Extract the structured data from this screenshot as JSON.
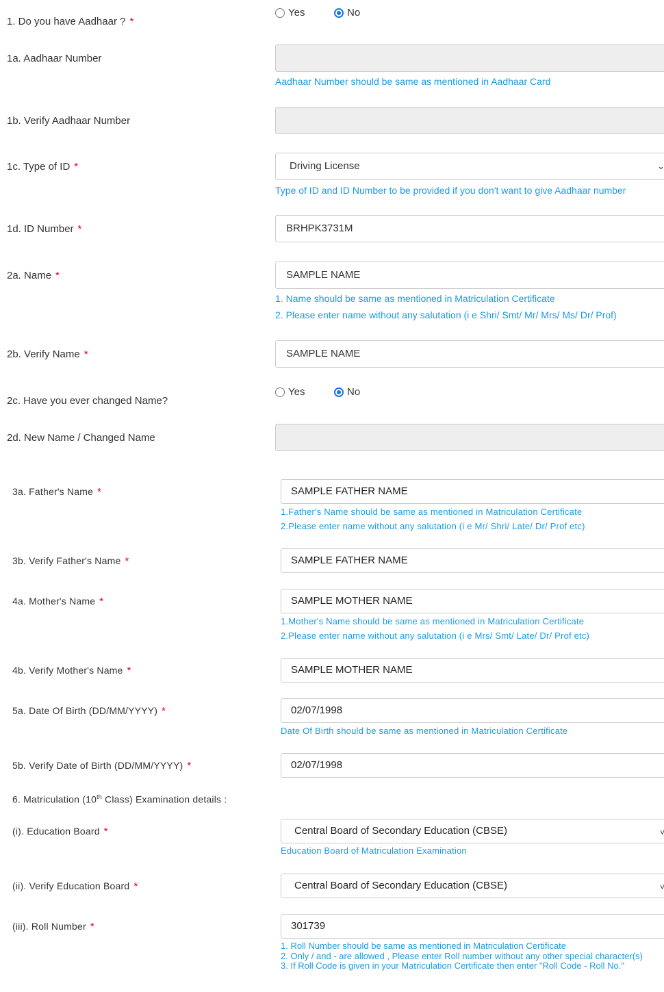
{
  "q1": {
    "label": "1. Do you have Aadhaar ?",
    "req": "*",
    "opt_yes": "Yes",
    "opt_no": "No",
    "selected": "No"
  },
  "q1a": {
    "label": "1a. Aadhaar Number",
    "value": "",
    "help": "Aadhaar Number should be same as mentioned in Aadhaar Card"
  },
  "q1b": {
    "label": "1b. Verify Aadhaar Number",
    "value": ""
  },
  "q1c": {
    "label": "1c. Type of ID",
    "req": "*",
    "value": "Driving License",
    "help": "Type of ID and ID Number to be provided if you don't want to give Aadhaar number"
  },
  "q1d": {
    "label": "1d. ID Number",
    "req": "*",
    "value": "BRHPK3731M"
  },
  "q2a": {
    "label": "2a. Name",
    "req": "*",
    "value": "SAMPLE NAME",
    "help1": "1. Name should be same as mentioned in Matriculation Certificate",
    "help2": "2. Please enter name without any salutation (i e Shri/ Smt/ Mr/ Mrs/ Ms/ Dr/ Prof)"
  },
  "q2b": {
    "label": "2b. Verify Name",
    "req": "*",
    "value": "SAMPLE NAME"
  },
  "q2c": {
    "label": "2c. Have you ever changed Name?",
    "opt_yes": "Yes",
    "opt_no": "No",
    "selected": "No"
  },
  "q2d": {
    "label": "2d. New Name / Changed Name",
    "value": ""
  },
  "q3a": {
    "label": "3a. Father's Name",
    "req": "*",
    "value": "SAMPLE FATHER NAME",
    "help1": "1.Father's Name should be same as mentioned in Matriculation Certificate",
    "help2": "2.Please enter name without any salutation (i e Mr/ Shri/ Late/ Dr/ Prof etc)"
  },
  "q3b": {
    "label": "3b. Verify Father's Name",
    "req": "*",
    "value": "SAMPLE FATHER NAME"
  },
  "q4a": {
    "label": "4a. Mother's Name",
    "req": "*",
    "value": "SAMPLE MOTHER NAME",
    "help1": "1.Mother's Name should be same as mentioned in Matriculation Certificate",
    "help2": "2.Please enter name without any salutation (i e Mrs/ Smt/ Late/ Dr/ Prof etc)"
  },
  "q4b": {
    "label": "4b. Verify Mother's Name",
    "req": "*",
    "value": "SAMPLE MOTHER NAME"
  },
  "q5a": {
    "label": "5a. Date Of Birth (DD/MM/YYYY)",
    "req": "*",
    "value": "02/07/1998",
    "help": "Date Of Birth should be same as mentioned in Matriculation Certificate"
  },
  "q5b": {
    "label": "5b. Verify Date of Birth (DD/MM/YYYY)",
    "req": "*",
    "value": "02/07/1998"
  },
  "q6": {
    "label_pre": "6. Matriculation (10",
    "label_sup": "th",
    "label_post": " Class) Examination details :"
  },
  "q6i": {
    "label": "(i). Education Board",
    "req": "*",
    "value": "Central Board of Secondary Education (CBSE)",
    "help": "Education Board of Matriculation Examination"
  },
  "q6ii": {
    "label": "(ii). Verify Education Board",
    "req": "*",
    "value": "Central Board of Secondary Education (CBSE)"
  },
  "q6iii": {
    "label": "(iii). Roll Number",
    "req": "*",
    "value": "301739",
    "help1": "1. Roll Number should be same as mentioned in Matriculation Certificate",
    "help2": "2. Only / and - are allowed , Please enter Roll number without any other special character(s)",
    "help3": "3. If Roll Code is given in your Matriculation Certificate then enter \"Roll Code - Roll No.\""
  },
  "colors": {
    "required": "#e0001b",
    "help": "#1b9ae0",
    "radio_selected": "#1a73e8",
    "disabled_bg": "#eeeeee"
  }
}
